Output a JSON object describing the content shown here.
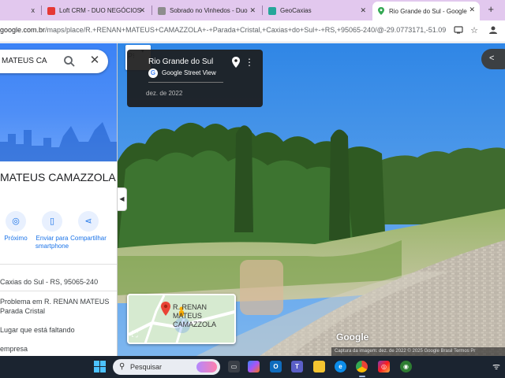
{
  "browser": {
    "tabs": [
      {
        "label": "x",
        "favicon_color": "#9e9e9e",
        "active": false
      },
      {
        "label": "Loft CRM - DUO NEGÓCIOS",
        "favicon_color": "#e53935",
        "active": false
      },
      {
        "label": "Sobrado no Vinhedos - Duo",
        "favicon_color": "#8d8d8d",
        "active": false
      },
      {
        "label": "GeoCaxias",
        "favicon_color": "#26a69a",
        "active": false
      },
      {
        "label": "Rio Grande do Sul - Google",
        "favicon_color": "#34a853",
        "active": true
      }
    ],
    "new_tab_icon": "plus-icon",
    "url_host": "google.com.br",
    "url_path": "/maps/place/R.+RENAN+MATEUS+CAMAZZOLA+-+Parada+Cristal,+Caxias+do+Sul+-+RS,+95065-240/@-29.0773171,-51.0965873..."
  },
  "maps": {
    "search_value": "MATEUS CAMAZZOLA",
    "place_title_line1": "MATEUS CAMAZZOLA -",
    "place_title_line2": "",
    "actions": [
      {
        "label": "Próximo",
        "icon": "nearby-icon"
      },
      {
        "label": "Enviar para smartphone",
        "icon": "phone-icon"
      },
      {
        "label": "Compartilhar",
        "icon": "share-icon"
      }
    ],
    "address": "Caxias do Sul - RS, 95065-240",
    "report_problem": "Problema em R. RENAN MATEUS",
    "report_problem_2": "Parada Cristal",
    "missing_place": "Lugar que está faltando",
    "business": "empresa"
  },
  "street_view": {
    "title": "Rio Grande do Sul",
    "subtitle": "Google Street View",
    "date": "dez. de 2022",
    "google_logo": "Google",
    "attribution": "Captura da imagem: dez. de 2022   © 2025 Google   Brasil   Termos   Pr",
    "minimap_label_line1": "R. RENAN MATEUS",
    "minimap_label_line2": "CAMAZZOLA"
  },
  "taskbar": {
    "search_placeholder": "Pesquisar"
  },
  "colors": {
    "tab_strip": "#e2c8ee",
    "maps_blue": "#1a73e8",
    "sky": "#3b8ce8",
    "taskbar": "#1b2430"
  }
}
